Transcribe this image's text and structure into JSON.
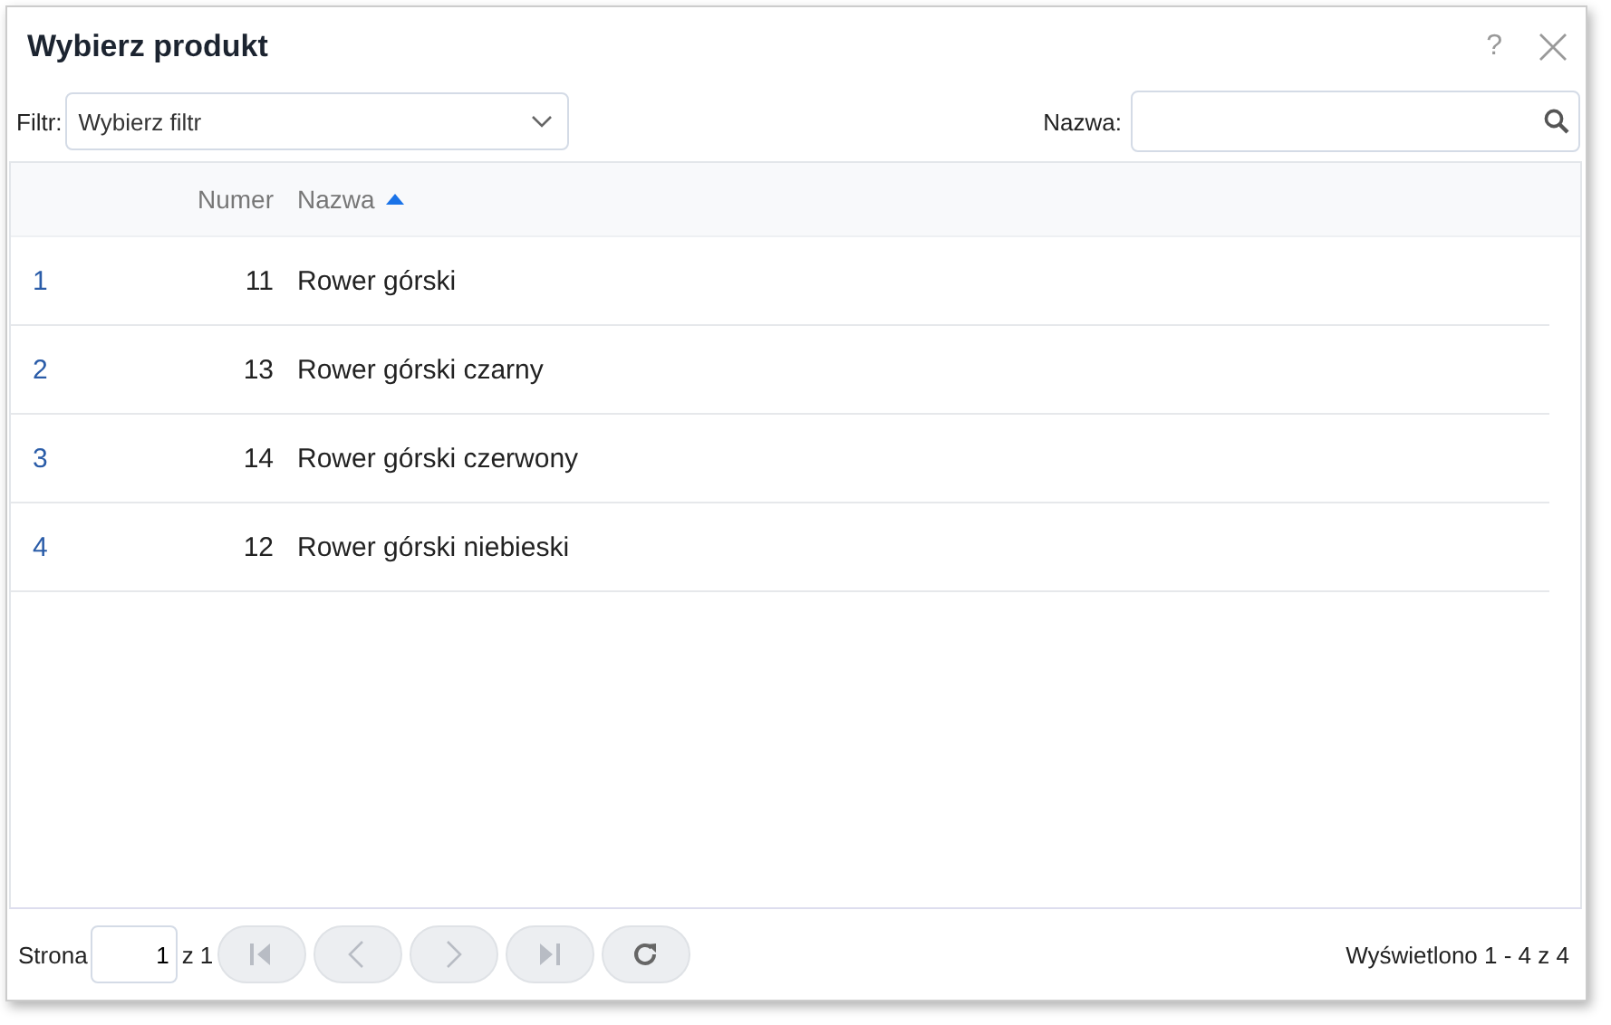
{
  "window": {
    "title": "Wybierz produkt",
    "help": "?"
  },
  "filter": {
    "label": "Filtr:",
    "placeholder": "Wybierz filtr"
  },
  "search": {
    "label": "Nazwa:"
  },
  "table": {
    "columns": [
      {
        "label": "Numer",
        "sorted": false
      },
      {
        "label": "Nazwa",
        "sorted": true
      }
    ],
    "rows": [
      {
        "index": "1",
        "number": "11",
        "name": "Rower górski"
      },
      {
        "index": "2",
        "number": "13",
        "name": "Rower górski czarny"
      },
      {
        "index": "3",
        "number": "14",
        "name": "Rower górski czerwony"
      },
      {
        "index": "4",
        "number": "12",
        "name": "Rower górski niebieski"
      }
    ]
  },
  "pager": {
    "label": "Strona",
    "page": "1",
    "of": "z 1",
    "buttons": [
      {
        "kind": "first",
        "disabled": true
      },
      {
        "kind": "prev",
        "disabled": true
      },
      {
        "kind": "next",
        "disabled": true
      },
      {
        "kind": "last",
        "disabled": true
      },
      {
        "kind": "refresh",
        "disabled": false
      }
    ],
    "summary": "Wyświetlono 1 - 4 z 4"
  }
}
